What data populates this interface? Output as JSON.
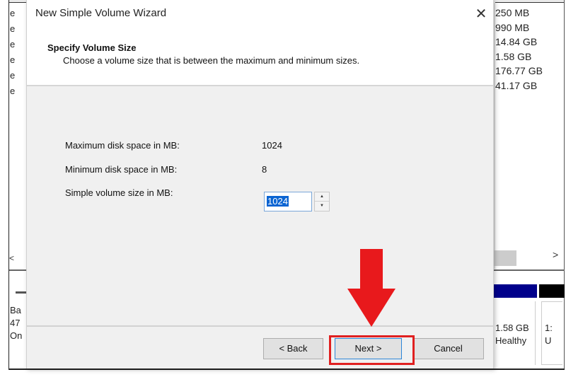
{
  "background_window": {
    "column_fragment_letters": [
      "e",
      "e",
      "e",
      "e",
      "e",
      "e"
    ],
    "free_space_values": [
      "250 MB",
      "990 MB",
      "14.84 GB",
      "1.58 GB",
      "176.77 GB",
      "41.17 GB"
    ],
    "scroll_left_glyph": "<",
    "scroll_right_glyph": ">",
    "disk_label_lines": [
      "Ba",
      "47",
      "On"
    ],
    "volume_info": {
      "size": "1.58 GB",
      "status": "Healthy"
    },
    "volume_info_2": {
      "size": "1:",
      "status": "U"
    },
    "colors": {
      "primary_partition": "#00008b",
      "unallocated": "#000000"
    }
  },
  "dialog": {
    "title": "New Simple Volume Wizard",
    "close_glyph": "✕",
    "heading": "Specify Volume Size",
    "subheading": "Choose a volume size that is between the maximum and minimum sizes.",
    "fields": {
      "max_label": "Maximum disk space in MB:",
      "max_value": "1024",
      "min_label": "Minimum disk space in MB:",
      "min_value": "8",
      "size_label": "Simple volume size in MB:",
      "size_value": "1024"
    },
    "spinner": {
      "up_glyph": "▲",
      "down_glyph": "▼"
    },
    "buttons": {
      "back": "< Back",
      "next": "Next >",
      "cancel": "Cancel"
    }
  },
  "annotation": {
    "arrow_color": "#e8191c",
    "highlight_color": "#e02020",
    "target": "Next >"
  }
}
